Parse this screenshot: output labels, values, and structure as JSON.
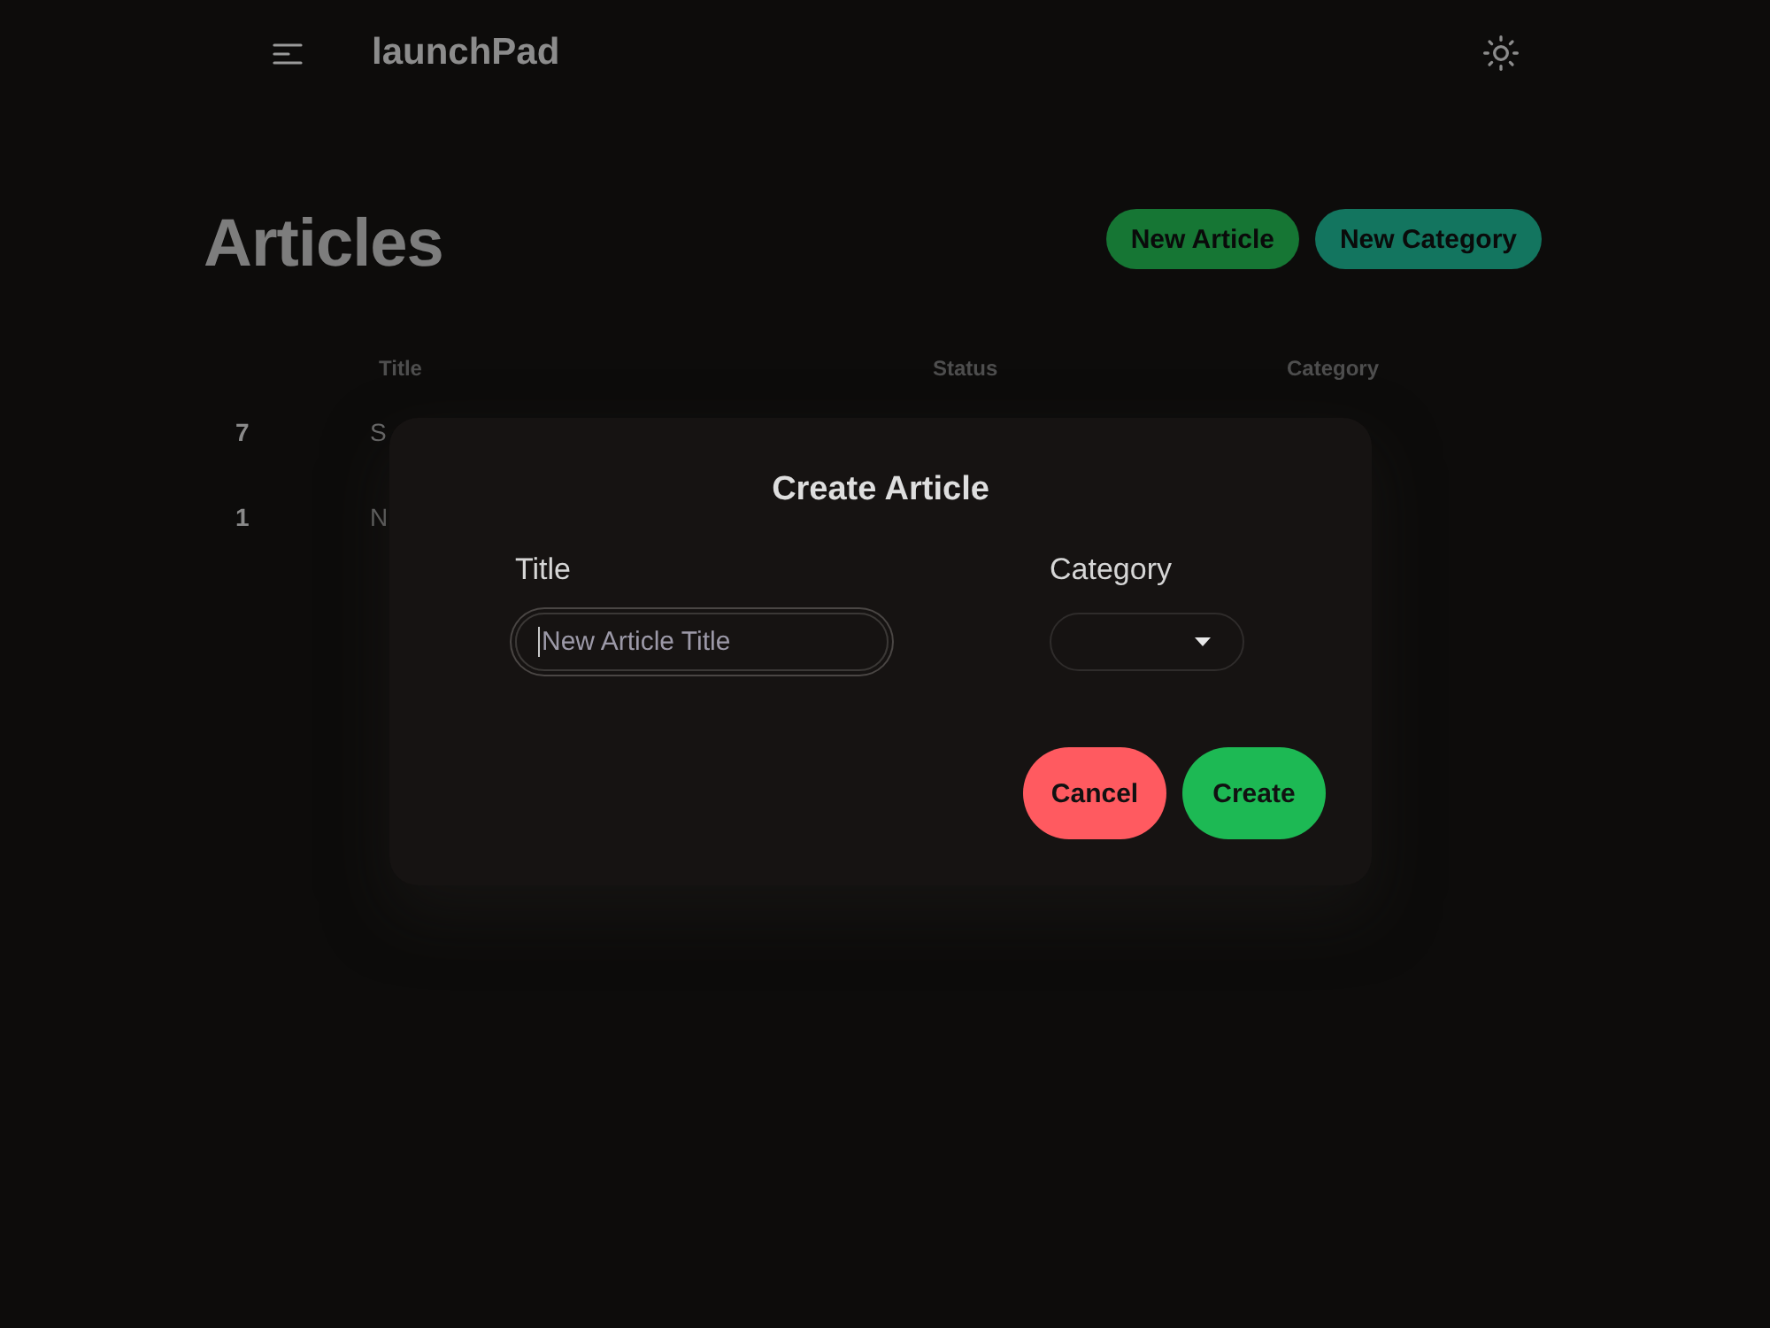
{
  "app_bar": {
    "title": "launchPad"
  },
  "page": {
    "heading": "Articles",
    "actions": [
      {
        "label": "New Article",
        "kind": "primary"
      },
      {
        "label": "New Category",
        "kind": "secondary"
      }
    ]
  },
  "table": {
    "columns": [
      "Title",
      "Status",
      "Category"
    ],
    "rows": [
      {
        "number": "7",
        "title": "S"
      },
      {
        "number": "1",
        "title": "N"
      }
    ]
  },
  "dialog": {
    "title": "Create Article",
    "fields": [
      {
        "kind": "text",
        "label": "Title",
        "placeholder": "New Article Title",
        "focused": true
      },
      {
        "kind": "select",
        "label": "Category"
      }
    ],
    "buttons": [
      {
        "label": "Cancel",
        "kind": "cancel"
      },
      {
        "label": "Create",
        "kind": "confirm"
      }
    ]
  }
}
